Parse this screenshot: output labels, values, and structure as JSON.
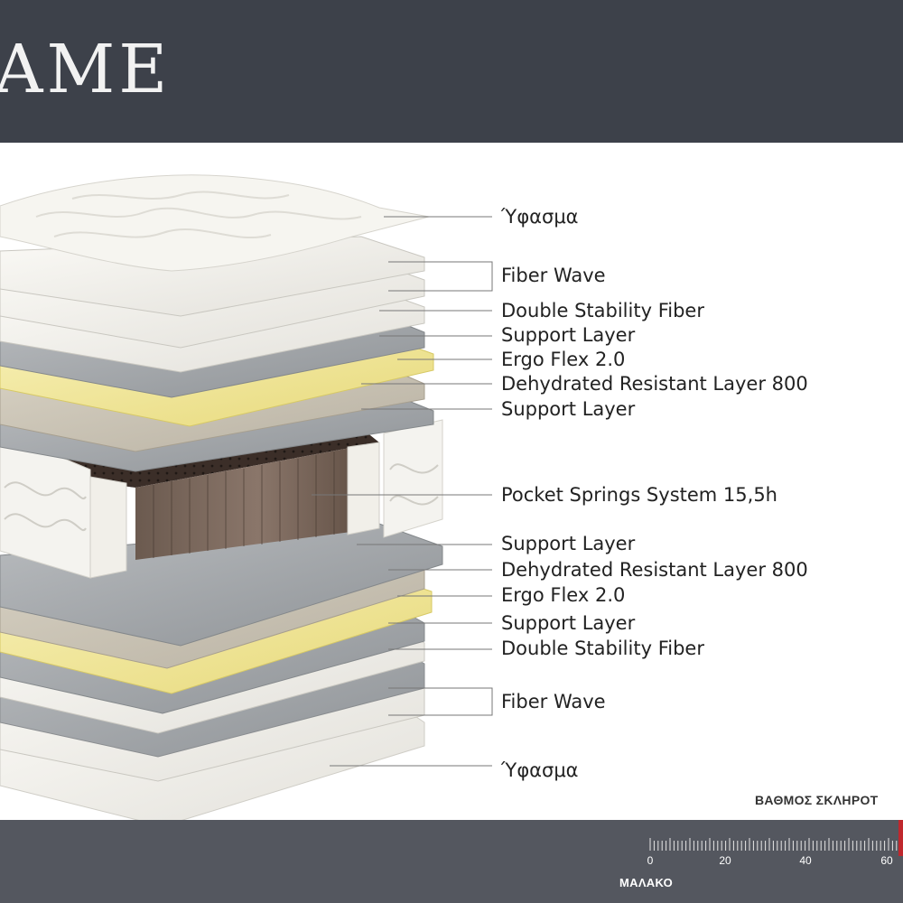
{
  "header": {
    "title": "AME"
  },
  "layers": [
    {
      "label": "Ύφασμα"
    },
    {
      "label": "Fiber Wave"
    },
    {
      "label": "Double Stability Fiber"
    },
    {
      "label": "Support Layer"
    },
    {
      "label": "Ergo Flex 2.0"
    },
    {
      "label": "Dehydrated Resistant Layer 800"
    },
    {
      "label": "Support Layer"
    },
    {
      "label": "Pocket Springs System 15,5h"
    },
    {
      "label": "Support Layer"
    },
    {
      "label": "Dehydrated Resistant Layer 800"
    },
    {
      "label": "Ergo Flex 2.0"
    },
    {
      "label": "Support Layer"
    },
    {
      "label": "Double Stability Fiber"
    },
    {
      "label": "Fiber Wave"
    },
    {
      "label": "Ύφασμα"
    }
  ],
  "firmness": {
    "title": "ΒΑΘΜΟΣ ΣΚΛΗΡΟΤ",
    "scale_labels": [
      "0",
      "20",
      "40",
      "60"
    ],
    "min_label": "ΜΑΛΑΚΟ"
  },
  "colors": {
    "header_bg": "#3d414a",
    "footer_bg": "#54575f",
    "foam_white": "#f3f2ee",
    "fiber_grey": "#a9acaf",
    "ergo_yellow": "#f2e79a",
    "spring_brown": "#5a4a40",
    "marker_red": "#c0272d"
  }
}
